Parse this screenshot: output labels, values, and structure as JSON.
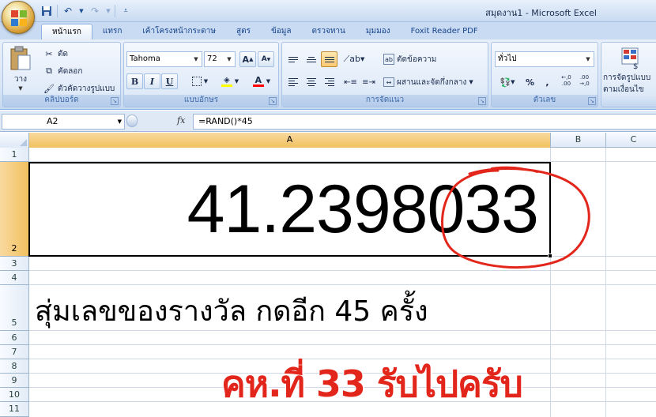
{
  "window": {
    "title": "สมุดงาน1 - Microsoft Excel"
  },
  "quick_access": [
    "save-icon",
    "undo-icon",
    "redo-icon",
    "customize-icon"
  ],
  "tabs": [
    {
      "label": "หน้าแรก",
      "active": true
    },
    {
      "label": "แทรก"
    },
    {
      "label": "เค้าโครงหน้ากระดาษ"
    },
    {
      "label": "สูตร"
    },
    {
      "label": "ข้อมูล"
    },
    {
      "label": "ตรวจทาน"
    },
    {
      "label": "มุมมอง"
    },
    {
      "label": "Foxit Reader PDF"
    }
  ],
  "ribbon": {
    "clipboard": {
      "label": "คลิปบอร์ด",
      "paste": "วาง",
      "cut": "ตัด",
      "copy": "คัดลอก",
      "format_painter": "ตัวคัดวางรูปแบบ"
    },
    "font": {
      "label": "แบบอักษร",
      "name": "Tahoma",
      "size": "72",
      "bold": "B",
      "italic": "I",
      "underline": "U",
      "grow": "A",
      "shrink": "A",
      "font_color_letter": "A",
      "fill_color": "#ffff00",
      "font_color": "#ff0000"
    },
    "alignment": {
      "label": "การจัดแนว",
      "wrap": "ตัดข้อความ",
      "merge": "ผสานและจัดกึ่งกลาง"
    },
    "number": {
      "label": "ตัวเลข",
      "format": "ทั่วไป",
      "percent": "%",
      "comma": ",",
      "inc_decimal": ",00 .0",
      "dec_decimal": ".00 ,0"
    },
    "styles": {
      "conditional_line1": "การจัดรูปแบบ",
      "conditional_line2": "ตามเงื่อนไข"
    }
  },
  "formula_bar": {
    "name_box": "A2",
    "fx": "fx",
    "formula": "=RAND()*45"
  },
  "sheet": {
    "columns": [
      "A",
      "B",
      "C"
    ],
    "rows": [
      "1",
      "2",
      "3",
      "4",
      "5",
      "6",
      "7",
      "8",
      "9",
      "10",
      "11"
    ],
    "a2_value": "41.2398033",
    "a5_text": "สุ่มเลขของรางวัล กดอีก 45 ครั้ง",
    "annotation": "คห.ที่ 33 รับไปครับ"
  },
  "colors": {
    "annotation_red": "#e2261b",
    "selection_header": "#f1c15f"
  }
}
